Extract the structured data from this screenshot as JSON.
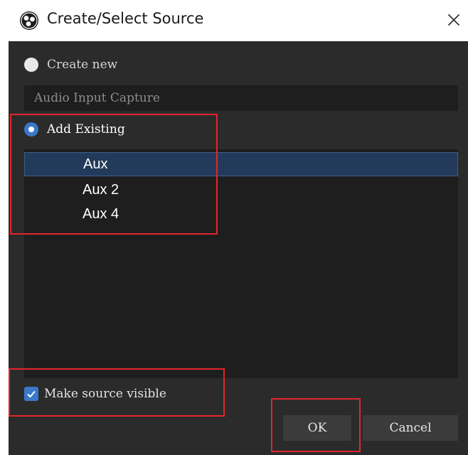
{
  "window": {
    "title": "Create/Select Source",
    "logo_icon": "obs-logo-icon",
    "close_icon": "close-icon"
  },
  "create_new": {
    "label": "Create new",
    "selected": false,
    "name_value": "Audio Input Capture"
  },
  "add_existing": {
    "label": "Add Existing",
    "selected": true,
    "items": [
      "Aux",
      "Aux 2",
      "Aux 4"
    ],
    "selected_item": "Aux"
  },
  "make_visible": {
    "label": "Make source visible",
    "checked": true
  },
  "buttons": {
    "ok_label": "OK",
    "cancel_label": "Cancel"
  },
  "colors": {
    "dialog_bg": "#2b2b2b",
    "field_bg": "#1e1e1e",
    "accent": "#3a78c8",
    "selection": "#243a5a",
    "highlight_annotation": "#e2262b"
  }
}
